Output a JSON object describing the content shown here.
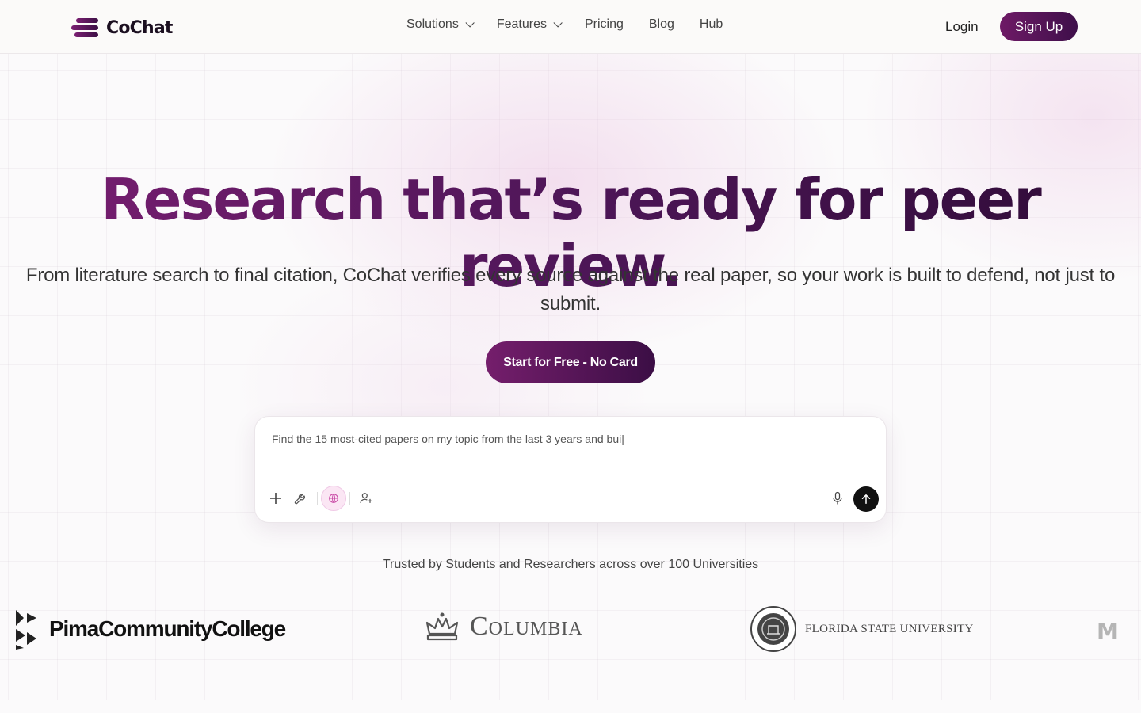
{
  "brand": {
    "name": "CoChat"
  },
  "nav": {
    "links": [
      {
        "label": "Solutions",
        "dropdown": true
      },
      {
        "label": "Features",
        "dropdown": true
      },
      {
        "label": "Pricing"
      },
      {
        "label": "Blog"
      },
      {
        "label": "Hub"
      }
    ],
    "login": "Login",
    "signup": "Sign Up"
  },
  "hero": {
    "title": "Research that’s ready for peer review.",
    "subtitle": "From literature search to final citation, CoChat verifies every source against the real paper, so your work is built to defend, not just to submit.",
    "cta": "Start for Free - No Card"
  },
  "chat": {
    "input_value": "Find the 15 most-cited papers on my topic from the last 3 years and bui|",
    "tools": [
      "plus-icon",
      "wrench-icon",
      "globe-icon",
      "add-user-icon",
      "microphone-icon",
      "send-arrow-icon"
    ]
  },
  "trusted": {
    "text": "Trusted by Students and Researchers across over 100 Universities",
    "logos": [
      "PimaCommunityCollege",
      "Columbia",
      "FLORIDA STATE UNIVERSITY",
      "M"
    ]
  },
  "colors": {
    "brand": "#6e1a66",
    "brand_dark": "#3b0e45",
    "send": "#111111"
  }
}
